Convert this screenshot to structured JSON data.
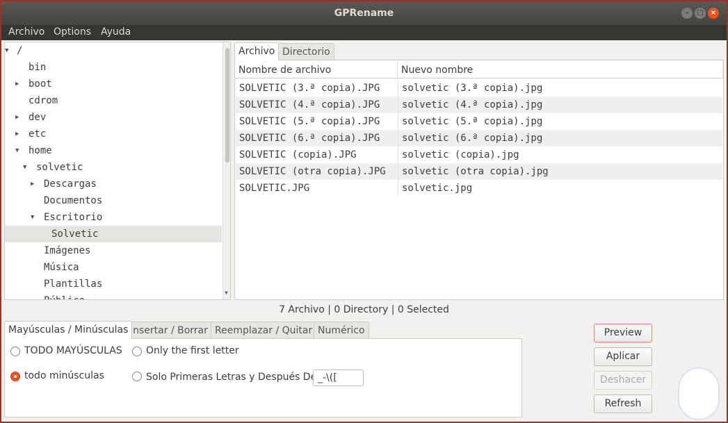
{
  "window": {
    "title": "GPRename",
    "controls": [
      "minimize",
      "maximize",
      "close"
    ]
  },
  "menu": [
    "Archivo",
    "Options",
    "Ayuda"
  ],
  "tree": [
    {
      "label": "/",
      "level": 0,
      "expander": "expanded"
    },
    {
      "label": "bin",
      "level": 1,
      "expander": "none"
    },
    {
      "label": "boot",
      "level": 1,
      "expander": "collapsed"
    },
    {
      "label": "cdrom",
      "level": 1,
      "expander": "none"
    },
    {
      "label": "dev",
      "level": 1,
      "expander": "collapsed"
    },
    {
      "label": "etc",
      "level": 1,
      "expander": "collapsed"
    },
    {
      "label": "home",
      "level": 1,
      "expander": "expanded"
    },
    {
      "label": "solvetic",
      "level": 2,
      "expander": "expanded"
    },
    {
      "label": "Descargas",
      "level": 3,
      "expander": "collapsed"
    },
    {
      "label": "Documentos",
      "level": 3,
      "expander": "none"
    },
    {
      "label": "Escritorio",
      "level": 3,
      "expander": "expanded"
    },
    {
      "label": "Solvetic",
      "level": 4,
      "expander": "none",
      "selected": true
    },
    {
      "label": "Imágenes",
      "level": 3,
      "expander": "none"
    },
    {
      "label": "Música",
      "level": 3,
      "expander": "none"
    },
    {
      "label": "Plantillas",
      "level": 3,
      "expander": "none"
    },
    {
      "label": "Público",
      "level": 3,
      "expander": "none"
    }
  ],
  "file_tabs": [
    "Archivo",
    "Directorio"
  ],
  "columns": [
    "Nombre de archivo",
    "Nuevo nombre"
  ],
  "files": [
    [
      "SOLVETIC (3.ª copia).JPG",
      "solvetic (3.ª copia).jpg"
    ],
    [
      "SOLVETIC (4.ª copia).JPG",
      "solvetic (4.ª copia).jpg"
    ],
    [
      "SOLVETIC (5.ª copia).JPG",
      "solvetic (5.ª copia).jpg"
    ],
    [
      "SOLVETIC (6.ª copia).JPG",
      "solvetic (6.ª copia).jpg"
    ],
    [
      "SOLVETIC (copia).JPG",
      "solvetic (copia).jpg"
    ],
    [
      "SOLVETIC (otra copia).JPG",
      "solvetic (otra copia).jpg"
    ],
    [
      "SOLVETIC.JPG",
      "solvetic.jpg"
    ]
  ],
  "status": "7 Archivo | 0 Directory | 0 Selected",
  "option_tabs": [
    "Mayúsculas / Minúsculas",
    "Insertar / Borrar",
    "Reemplazar / Quitar",
    "Numérico"
  ],
  "options": {
    "upper": "TODO MAYÚSCULAS",
    "first": "Only the first letter",
    "lower": "todo minúsculas",
    "after": "Solo Primeras Letras y Después De",
    "after_value": "_-\\([",
    "selected": "lower"
  },
  "buttons": {
    "preview": "Preview",
    "apply": "Aplicar",
    "undo": "Deshacer",
    "refresh": "Refresh"
  },
  "accent": "#e95420"
}
